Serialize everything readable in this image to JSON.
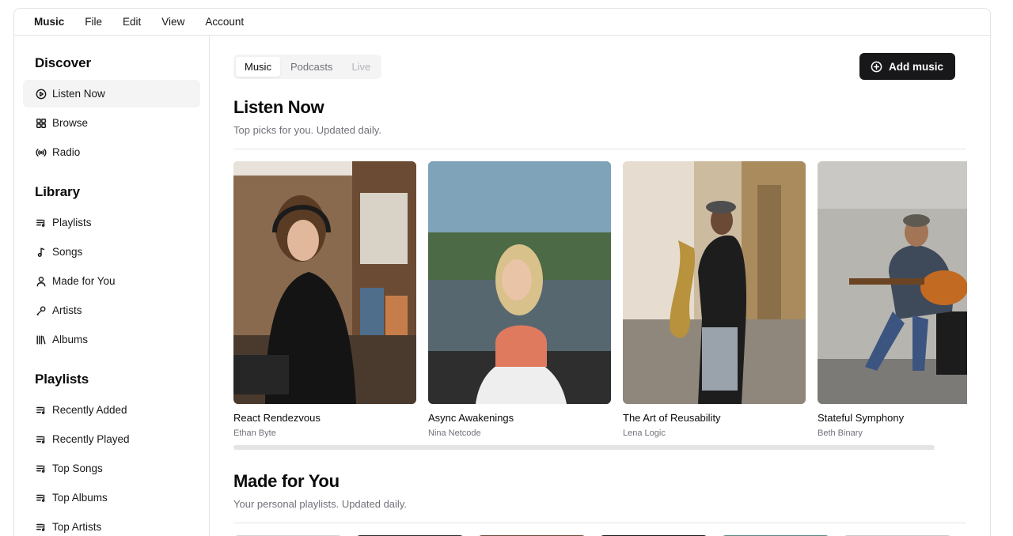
{
  "menubar": {
    "brand": "Music",
    "items": [
      "File",
      "Edit",
      "View",
      "Account"
    ]
  },
  "sidebar": {
    "discover": {
      "heading": "Discover",
      "items": [
        {
          "label": "Listen Now",
          "icon": "play-circle-icon"
        },
        {
          "label": "Browse",
          "icon": "grid-icon"
        },
        {
          "label": "Radio",
          "icon": "radio-icon"
        }
      ]
    },
    "library": {
      "heading": "Library",
      "items": [
        {
          "label": "Playlists",
          "icon": "playlist-icon"
        },
        {
          "label": "Songs",
          "icon": "music-note-icon"
        },
        {
          "label": "Made for You",
          "icon": "user-icon"
        },
        {
          "label": "Artists",
          "icon": "microphone-icon"
        },
        {
          "label": "Albums",
          "icon": "library-icon"
        }
      ]
    },
    "playlists": {
      "heading": "Playlists",
      "items": [
        {
          "label": "Recently Added",
          "icon": "playlist-icon"
        },
        {
          "label": "Recently Played",
          "icon": "playlist-icon"
        },
        {
          "label": "Top Songs",
          "icon": "playlist-icon"
        },
        {
          "label": "Top Albums",
          "icon": "playlist-icon"
        },
        {
          "label": "Top Artists",
          "icon": "playlist-icon"
        }
      ]
    }
  },
  "tabs": [
    {
      "label": "Music",
      "state": "active"
    },
    {
      "label": "Podcasts",
      "state": "normal"
    },
    {
      "label": "Live",
      "state": "disabled"
    }
  ],
  "add_button": {
    "label": "Add music",
    "icon": "plus-circle-icon"
  },
  "listen_now": {
    "title": "Listen Now",
    "subtitle": "Top picks for you. Updated daily.",
    "albums": [
      {
        "title": "React Rendezvous",
        "artist": "Ethan Byte"
      },
      {
        "title": "Async Awakenings",
        "artist": "Nina Netcode"
      },
      {
        "title": "The Art of Reusability",
        "artist": "Lena Logic"
      },
      {
        "title": "Stateful Symphony",
        "artist": "Beth Binary"
      }
    ]
  },
  "made_for_you": {
    "title": "Made for You",
    "subtitle": "Your personal playlists. Updated daily."
  },
  "colors": {
    "accent": "#18181b",
    "muted_text": "#71717a",
    "border": "#e4e4e7",
    "active_bg": "#f4f4f5"
  }
}
